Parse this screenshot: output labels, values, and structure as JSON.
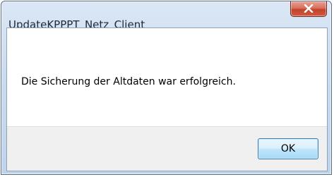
{
  "window": {
    "title": "UpdateKPPPT_Netz_Client",
    "close_icon": "close-icon"
  },
  "dialog": {
    "message": "Die Sicherung der Altdaten war erfolgreich.",
    "ok_label": "OK"
  },
  "colors": {
    "close_button": "#c2432c",
    "ok_button_border": "#3c7fb1"
  }
}
